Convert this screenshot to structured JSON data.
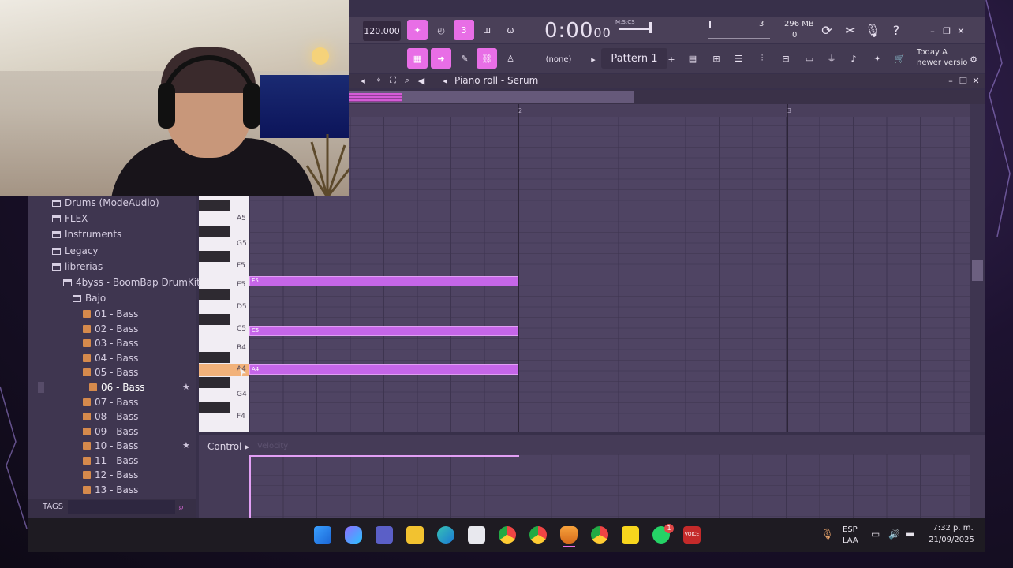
{
  "toolbar": {
    "tempo": "120.000",
    "time_display": "0:00",
    "time_small": "00",
    "time_label": "M:S:CS",
    "cpu_value": "3",
    "memory": "296 MB",
    "memory_sub": "0",
    "pattern": "Pattern 1",
    "snap": "(none)",
    "news_line1": "Today A",
    "news_line2": "newer versio",
    "colors": {
      "accent": "#e86ee6",
      "note": "#c566e8",
      "key_highlight": "#f2b27a"
    }
  },
  "piano_roll": {
    "title": "Piano roll - Serum",
    "bar_numbers": [
      "2",
      "3"
    ],
    "keys": [
      "A5",
      "G5",
      "F5",
      "E5",
      "D5",
      "C5",
      "B4",
      "A4",
      "G4",
      "F4"
    ],
    "notes": [
      "E5",
      "C5",
      "A4"
    ],
    "control_label": "Control",
    "control_param": "Velocity"
  },
  "browser": {
    "folders": [
      "Drums (ModeAudio)",
      "FLEX",
      "Instruments",
      "Legacy",
      "librerias",
      "4byss - BoomBap DrumKit",
      "Bajo"
    ],
    "files": [
      "01 - Bass",
      "02 - Bass",
      "03 - Bass",
      "04 - Bass",
      "05 - Bass",
      "06 - Bass",
      "07 - Bass",
      "08 - Bass",
      "09 - Bass",
      "10 - Bass",
      "11 - Bass",
      "12 - Bass",
      "13 - Bass"
    ],
    "tags_label": "TAGS"
  },
  "taskbar": {
    "lang_line1": "ESP",
    "lang_line2": "LAA",
    "time": "7:32 p. m.",
    "date": "21/09/2025",
    "whatsapp_badge": "1",
    "app_label": "VOICE"
  }
}
